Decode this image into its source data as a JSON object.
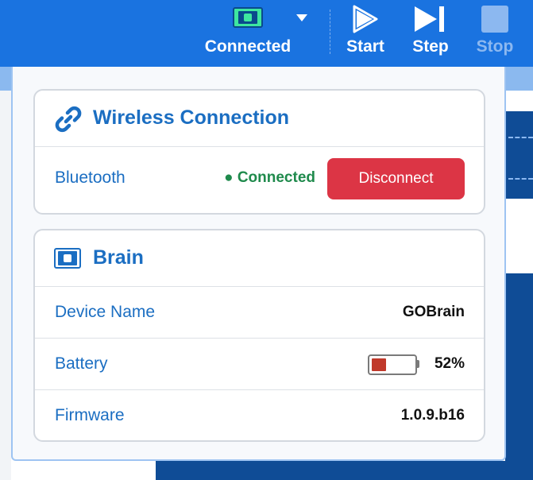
{
  "toolbar": {
    "connected_label": "Connected",
    "start_label": "Start",
    "step_label": "Step",
    "stop_label": "Stop"
  },
  "wireless": {
    "title": "Wireless Connection",
    "bluetooth_label": "Bluetooth",
    "status": "● Connected",
    "disconnect_label": "Disconnect"
  },
  "brain": {
    "title": "Brain",
    "device_name_label": "Device Name",
    "device_name_value": "GOBrain",
    "battery_label": "Battery",
    "battery_value": "52%",
    "battery_level": 0.52,
    "firmware_label": "Firmware",
    "firmware_value": "1.0.9.b16"
  },
  "colors": {
    "toolbar": "#1a73e0",
    "accent": "#1b6ec2",
    "connected": "#1f8a4c",
    "disconnect": "#dc3545",
    "battery_fill": "#c0392b"
  },
  "icons": {
    "connected": "brain-device-icon",
    "dropdown": "caret-down-icon",
    "start": "play-icon",
    "step": "step-forward-icon",
    "stop": "stop-icon",
    "wireless": "link-icon",
    "brain": "brain-device-icon"
  }
}
